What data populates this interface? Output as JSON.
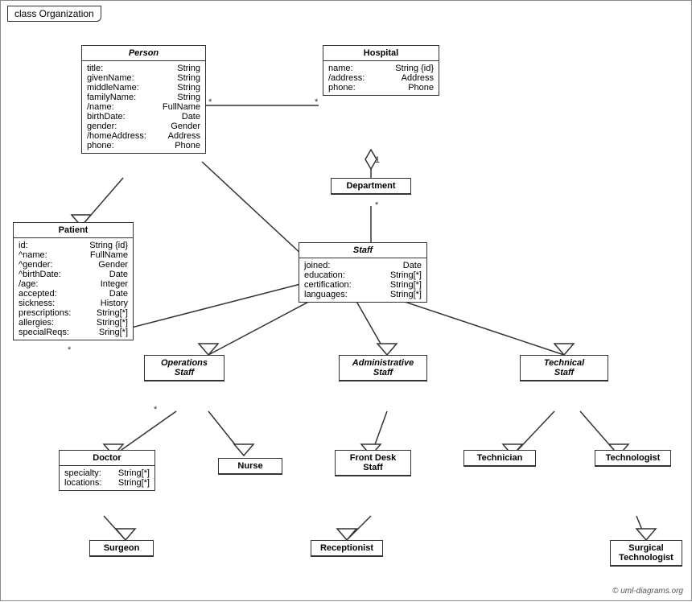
{
  "title": "class Organization",
  "copyright": "© uml-diagrams.org",
  "classes": {
    "person": {
      "name": "Person",
      "italic": true,
      "attrs": [
        {
          "name": "title:",
          "type": "String"
        },
        {
          "name": "givenName:",
          "type": "String"
        },
        {
          "name": "middleName:",
          "type": "String"
        },
        {
          "name": "familyName:",
          "type": "String"
        },
        {
          "name": "/name:",
          "type": "FullName"
        },
        {
          "name": "birthDate:",
          "type": "Date"
        },
        {
          "name": "gender:",
          "type": "Gender"
        },
        {
          "name": "/homeAddress:",
          "type": "Address"
        },
        {
          "name": "phone:",
          "type": "Phone"
        }
      ]
    },
    "hospital": {
      "name": "Hospital",
      "italic": false,
      "attrs": [
        {
          "name": "name:",
          "type": "String {id}"
        },
        {
          "name": "/address:",
          "type": "Address"
        },
        {
          "name": "phone:",
          "type": "Phone"
        }
      ]
    },
    "department": {
      "name": "Department",
      "italic": false,
      "attrs": []
    },
    "staff": {
      "name": "Staff",
      "italic": true,
      "attrs": [
        {
          "name": "joined:",
          "type": "Date"
        },
        {
          "name": "education:",
          "type": "String[*]"
        },
        {
          "name": "certification:",
          "type": "String[*]"
        },
        {
          "name": "languages:",
          "type": "String[*]"
        }
      ]
    },
    "patient": {
      "name": "Patient",
      "italic": false,
      "attrs": [
        {
          "name": "id:",
          "type": "String {id}"
        },
        {
          "name": "^name:",
          "type": "FullName"
        },
        {
          "name": "^gender:",
          "type": "Gender"
        },
        {
          "name": "^birthDate:",
          "type": "Date"
        },
        {
          "name": "/age:",
          "type": "Integer"
        },
        {
          "name": "accepted:",
          "type": "Date"
        },
        {
          "name": "sickness:",
          "type": "History"
        },
        {
          "name": "prescriptions:",
          "type": "String[*]"
        },
        {
          "name": "allergies:",
          "type": "String[*]"
        },
        {
          "name": "specialReqs:",
          "type": "Sring[*]"
        }
      ]
    },
    "operations_staff": {
      "name": "Operations\nStaff",
      "italic": true,
      "attrs": []
    },
    "administrative_staff": {
      "name": "Administrative\nStaff",
      "italic": true,
      "attrs": []
    },
    "technical_staff": {
      "name": "Technical\nStaff",
      "italic": true,
      "attrs": []
    },
    "doctor": {
      "name": "Doctor",
      "italic": false,
      "attrs": [
        {
          "name": "specialty:",
          "type": "String[*]"
        },
        {
          "name": "locations:",
          "type": "String[*]"
        }
      ]
    },
    "nurse": {
      "name": "Nurse",
      "italic": false,
      "attrs": []
    },
    "front_desk_staff": {
      "name": "Front Desk\nStaff",
      "italic": false,
      "attrs": []
    },
    "technician": {
      "name": "Technician",
      "italic": false,
      "attrs": []
    },
    "technologist": {
      "name": "Technologist",
      "italic": false,
      "attrs": []
    },
    "surgeon": {
      "name": "Surgeon",
      "italic": false,
      "attrs": []
    },
    "receptionist": {
      "name": "Receptionist",
      "italic": false,
      "attrs": []
    },
    "surgical_technologist": {
      "name": "Surgical\nTechnologist",
      "italic": false,
      "attrs": []
    }
  }
}
